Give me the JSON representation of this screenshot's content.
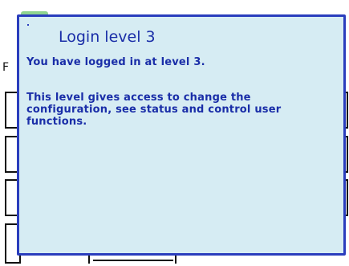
{
  "dialog": {
    "title": "Login level 3",
    "message1": "You have logged in at level 3.",
    "message2": "This level gives access to change the configuration, see status and control user functions."
  },
  "background": {
    "visible_glyph": "F"
  },
  "colors": {
    "dialog_bg": "#d6ecf3",
    "dialog_border": "#2a3dbd",
    "text": "#1a2ea8",
    "tab_green": "#8fd48f"
  }
}
